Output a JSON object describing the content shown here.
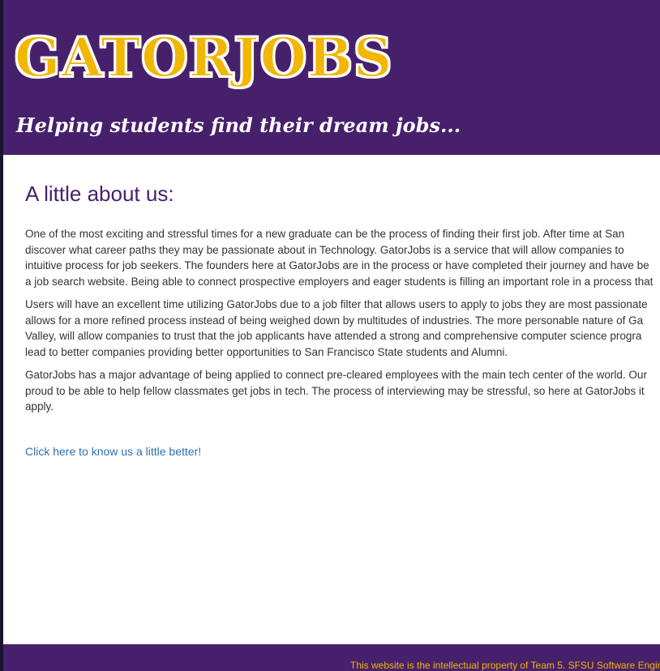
{
  "header": {
    "logo_text": "GATORJOBS",
    "tagline": "Helping students find their dream jobs..."
  },
  "main": {
    "heading": "A little about us:",
    "paragraphs": [
      {
        "lines": [
          "One of the most exciting and stressful times for a new graduate can be the process of finding their first job. After time at San",
          "discover what career paths they may be passionate about in Technology. GatorJobs is a service that will allow companies to",
          "intuitive process for job seekers. The founders here at GatorJobs are in the process or have completed their journey and have be",
          "a job search website. Being able to connect prospective employers and eager students is filling an important role in a process that"
        ]
      },
      {
        "lines": [
          "Users will have an excellent time utilizing GatorJobs due to a job filter that allows users to apply to jobs they are most passionate",
          "allows for a more refined process instead of being weighed down by multitudes of industries. The more personable nature of Ga",
          "Valley, will allow companies to trust that the job applicants have attended a strong and comprehensive computer science progra",
          "lead to better companies providing better opportunities to San Francisco State students and Alumni."
        ]
      },
      {
        "lines": [
          "GatorJobs has a major advantage of being applied to connect pre-cleared employees with the main tech center of the world. Our",
          "proud to be able to help fellow classmates get jobs in tech. The process of interviewing may be stressful, so here at GatorJobs it",
          "apply."
        ]
      }
    ],
    "link_text": "Click here to know us a little better!"
  },
  "footer": {
    "text": "This website is the intellectual property of Team 5. SFSU Software Engin"
  },
  "colors": {
    "brand_purple": "#47206c",
    "brand_gold": "#f2b705",
    "link_blue": "#2f6fb0"
  }
}
